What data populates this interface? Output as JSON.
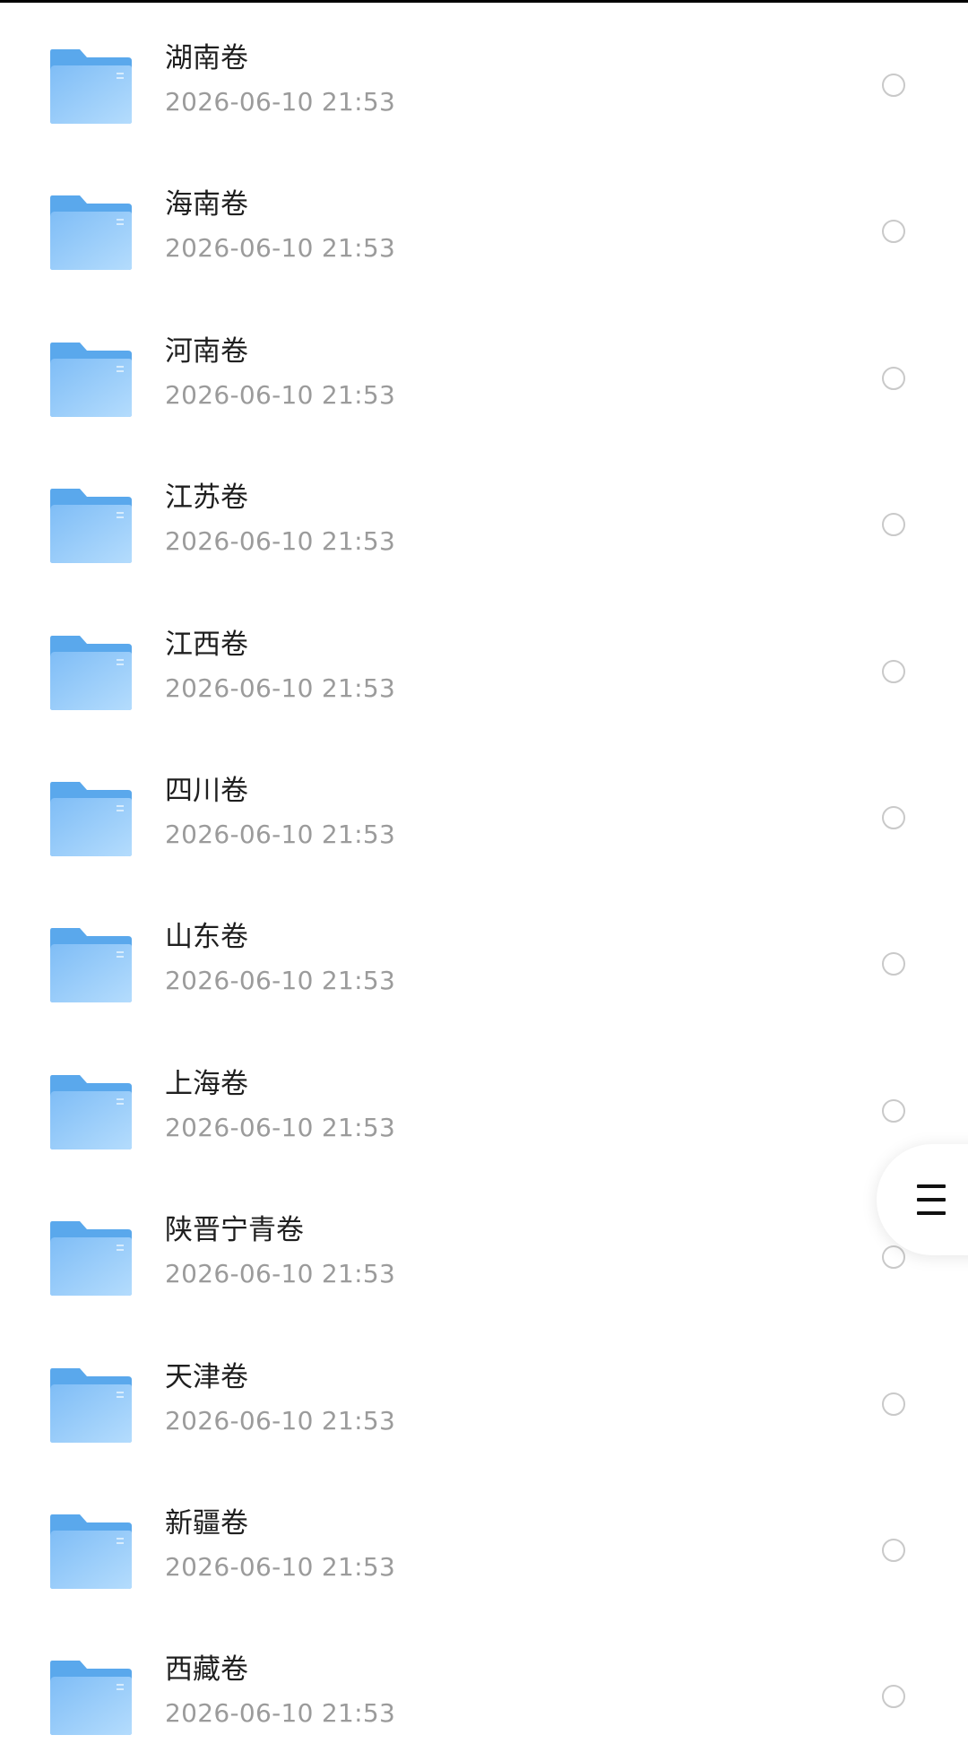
{
  "files": [
    {
      "name": "湖南卷",
      "date": "2026-06-10 21:53",
      "icon": "folder-icon"
    },
    {
      "name": "海南卷",
      "date": "2026-06-10 21:53",
      "icon": "folder-icon"
    },
    {
      "name": "河南卷",
      "date": "2026-06-10 21:53",
      "icon": "folder-icon"
    },
    {
      "name": "江苏卷",
      "date": "2026-06-10 21:53",
      "icon": "folder-icon"
    },
    {
      "name": "江西卷",
      "date": "2026-06-10 21:53",
      "icon": "folder-icon"
    },
    {
      "name": "四川卷",
      "date": "2026-06-10 21:53",
      "icon": "folder-icon"
    },
    {
      "name": "山东卷",
      "date": "2026-06-10 21:53",
      "icon": "folder-icon"
    },
    {
      "name": "上海卷",
      "date": "2026-06-10 21:53",
      "icon": "folder-icon"
    },
    {
      "name": "陕晋宁青卷",
      "date": "2026-06-10 21:53",
      "icon": "folder-icon"
    },
    {
      "name": "天津卷",
      "date": "2026-06-10 21:53",
      "icon": "folder-icon"
    },
    {
      "name": "新疆卷",
      "date": "2026-06-10 21:53",
      "icon": "folder-icon"
    },
    {
      "name": "西藏卷",
      "date": "2026-06-10 21:53",
      "icon": "folder-icon"
    }
  ],
  "floating_menu": {
    "icon": "menu-icon"
  },
  "colors": {
    "folder_back": "#5aa8ec",
    "folder_front": "#9ccdfb",
    "name_text": "#1f1f1f",
    "date_text": "#9b9b9b",
    "radio_border": "#c9c9c9"
  }
}
